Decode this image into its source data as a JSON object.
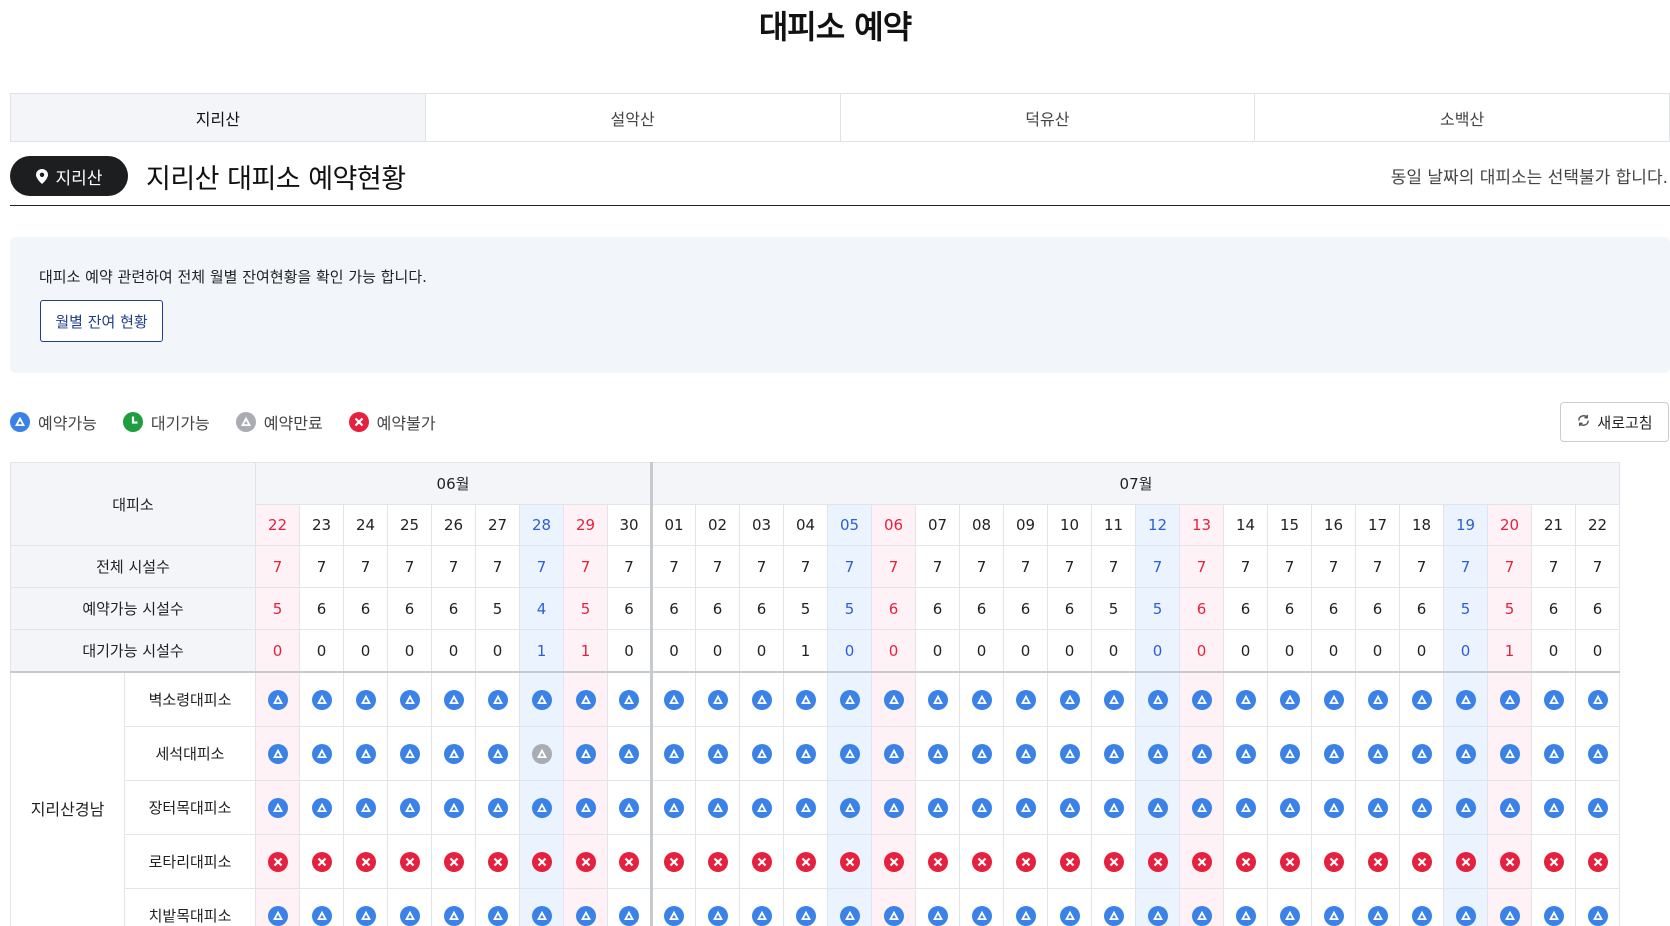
{
  "title": "대피소 예약",
  "tabs": [
    {
      "label": "지리산",
      "active": true
    },
    {
      "label": "설악산",
      "active": false
    },
    {
      "label": "덕유산",
      "active": false
    },
    {
      "label": "소백산",
      "active": false
    }
  ],
  "section": {
    "badge": "지리산",
    "title": "지리산 대피소 예약현황",
    "note": "동일 날짜의 대피소는 선택불가 합니다."
  },
  "info": {
    "text": "대피소 예약 관련하여 전체 월별 잔여현황을 확인 가능 합니다.",
    "button": "월별 잔여 현황"
  },
  "legend": [
    {
      "label": "예약가능",
      "icon": "available-icon",
      "color": "#3b82e6"
    },
    {
      "label": "대기가능",
      "icon": "clock-icon",
      "color": "#1e9e3e"
    },
    {
      "label": "예약만료",
      "icon": "expired-icon",
      "color": "#a9adb3"
    },
    {
      "label": "예약불가",
      "icon": "unavailable-icon",
      "color": "#e5213f"
    }
  ],
  "refresh_label": "새로고침",
  "table": {
    "header_label": "대피소",
    "months": [
      {
        "label": "06월",
        "span": 9
      },
      {
        "label": "07월",
        "span": 22
      }
    ],
    "days": [
      "22",
      "23",
      "24",
      "25",
      "26",
      "27",
      "28",
      "29",
      "30",
      "01",
      "02",
      "03",
      "04",
      "05",
      "06",
      "07",
      "08",
      "09",
      "10",
      "11",
      "12",
      "13",
      "14",
      "15",
      "16",
      "17",
      "18",
      "19",
      "20",
      "21",
      "22"
    ],
    "day_types": [
      "sun",
      "",
      "",
      "",
      "",
      "",
      "sat",
      "holiday",
      "",
      "",
      "",
      "",
      "",
      "sat",
      "sun",
      "",
      "",
      "",
      "",
      "",
      "sat",
      "sun",
      "",
      "",
      "",
      "",
      "",
      "sat",
      "sun",
      "",
      ""
    ],
    "stats": [
      {
        "label": "전체 시설수",
        "values": [
          "7",
          "7",
          "7",
          "7",
          "7",
          "7",
          "7",
          "7",
          "7",
          "7",
          "7",
          "7",
          "7",
          "7",
          "7",
          "7",
          "7",
          "7",
          "7",
          "7",
          "7",
          "7",
          "7",
          "7",
          "7",
          "7",
          "7",
          "7",
          "7",
          "7",
          "7"
        ]
      },
      {
        "label": "예약가능 시설수",
        "values": [
          "5",
          "6",
          "6",
          "6",
          "6",
          "5",
          "4",
          "5",
          "6",
          "6",
          "6",
          "6",
          "5",
          "5",
          "6",
          "6",
          "6",
          "6",
          "6",
          "5",
          "5",
          "6",
          "6",
          "6",
          "6",
          "6",
          "6",
          "5",
          "5",
          "6",
          "6"
        ]
      },
      {
        "label": "대기가능 시설수",
        "values": [
          "0",
          "0",
          "0",
          "0",
          "0",
          "0",
          "1",
          "1",
          "0",
          "0",
          "0",
          "0",
          "1",
          "0",
          "0",
          "0",
          "0",
          "0",
          "0",
          "0",
          "0",
          "0",
          "0",
          "0",
          "0",
          "0",
          "0",
          "0",
          "1",
          "0",
          "0"
        ]
      }
    ],
    "region": "지리산경남",
    "shelters": [
      {
        "name": "벽소령대피소",
        "status": "AAAAAAAAAAAAAAAAAAAAAAAAAAAAAAA"
      },
      {
        "name": "세석대피소",
        "status": "AAAAAAEAAAAAAAAAAAAAAAAAAAAAAAA"
      },
      {
        "name": "장터목대피소",
        "status": "AAAAAAAAAAAAAAAAAAAAAAAAAAAAAAA"
      },
      {
        "name": "로타리대피소",
        "status": "XXXXXXXXXXXXXXXXXXXXXXXXXXXXXXX"
      },
      {
        "name": "치밭목대피소",
        "status": "AAAAAAAAAAAAAAAAAAAAAAAAAAAAAAA"
      }
    ]
  }
}
